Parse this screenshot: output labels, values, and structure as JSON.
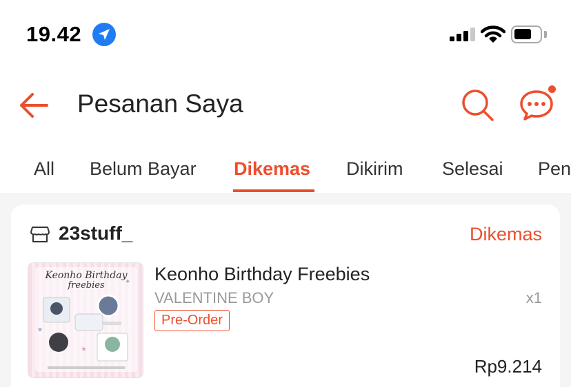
{
  "status_bar": {
    "time": "19.42",
    "location_icon": "location-arrow-icon",
    "signal_icon": "cellular-signal-icon",
    "wifi_icon": "wifi-icon",
    "battery_icon": "battery-icon",
    "battery_level": 0.7
  },
  "header": {
    "title": "Pesanan Saya",
    "back_icon": "back-arrow-icon",
    "search_icon": "search-icon",
    "chat_icon": "chat-icon",
    "chat_has_notification": true
  },
  "tabs": [
    {
      "label": "All",
      "active": false
    },
    {
      "label": "Belum Bayar",
      "active": false
    },
    {
      "label": "Dikemas",
      "active": true
    },
    {
      "label": "Dikirim",
      "active": false
    },
    {
      "label": "Selesai",
      "active": false
    },
    {
      "label": "Pen",
      "active": false
    }
  ],
  "order": {
    "shop_icon": "store-icon",
    "shop_name": "23stuff_",
    "status": "Dikemas",
    "product": {
      "name": "Keonho Birthday Freebies",
      "variant": "VALENTINE BOY",
      "quantity": "x1",
      "badge": "Pre-Order",
      "price": "Rp9.214",
      "thumbnail": {
        "title_line1": "Keonho Birthday",
        "title_line2": "freebies"
      }
    }
  },
  "colors": {
    "accent": "#ee4d2d",
    "background": "#f5f5f5",
    "card": "#ffffff",
    "muted_text": "#999999",
    "location_blue": "#1f7cf5"
  }
}
